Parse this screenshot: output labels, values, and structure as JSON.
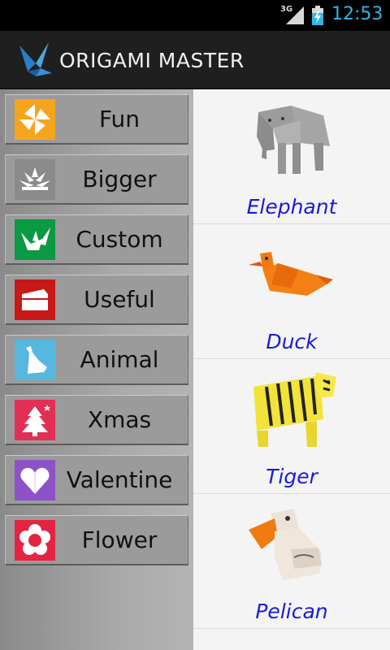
{
  "status_bar": {
    "network": "3G",
    "time": "12:53",
    "time_color": "#33b5e5"
  },
  "app": {
    "title": "ORIGAMI MASTER",
    "logo_icon": "origami-bird-icon"
  },
  "categories": [
    {
      "label": "Fun",
      "icon": "pinwheel-icon",
      "color": "#f6a41e"
    },
    {
      "label": "Bigger",
      "icon": "lotus-icon",
      "color": "#8a8a8a"
    },
    {
      "label": "Custom",
      "icon": "crane-icon",
      "color": "#0a9a43"
    },
    {
      "label": "Useful",
      "icon": "envelope-icon",
      "color": "#c81818"
    },
    {
      "label": "Animal",
      "icon": "bird-icon",
      "color": "#56b8de"
    },
    {
      "label": "Xmas",
      "icon": "tree-icon",
      "color": "#e22f55"
    },
    {
      "label": "Valentine",
      "icon": "heart-icon",
      "color": "#8e52c8"
    },
    {
      "label": "Flower",
      "icon": "flower-icon",
      "color": "#e52442"
    }
  ],
  "items": [
    {
      "label": "Elephant",
      "icon": "elephant-origami"
    },
    {
      "label": "Duck",
      "icon": "duck-origami"
    },
    {
      "label": "Tiger",
      "icon": "tiger-origami"
    },
    {
      "label": "Pelican",
      "icon": "pelican-origami"
    }
  ],
  "colors": {
    "link_text": "#1a1adc",
    "sidebar_bg": "#a9a9a9",
    "actionbar_bg": "#1f1f1f"
  }
}
